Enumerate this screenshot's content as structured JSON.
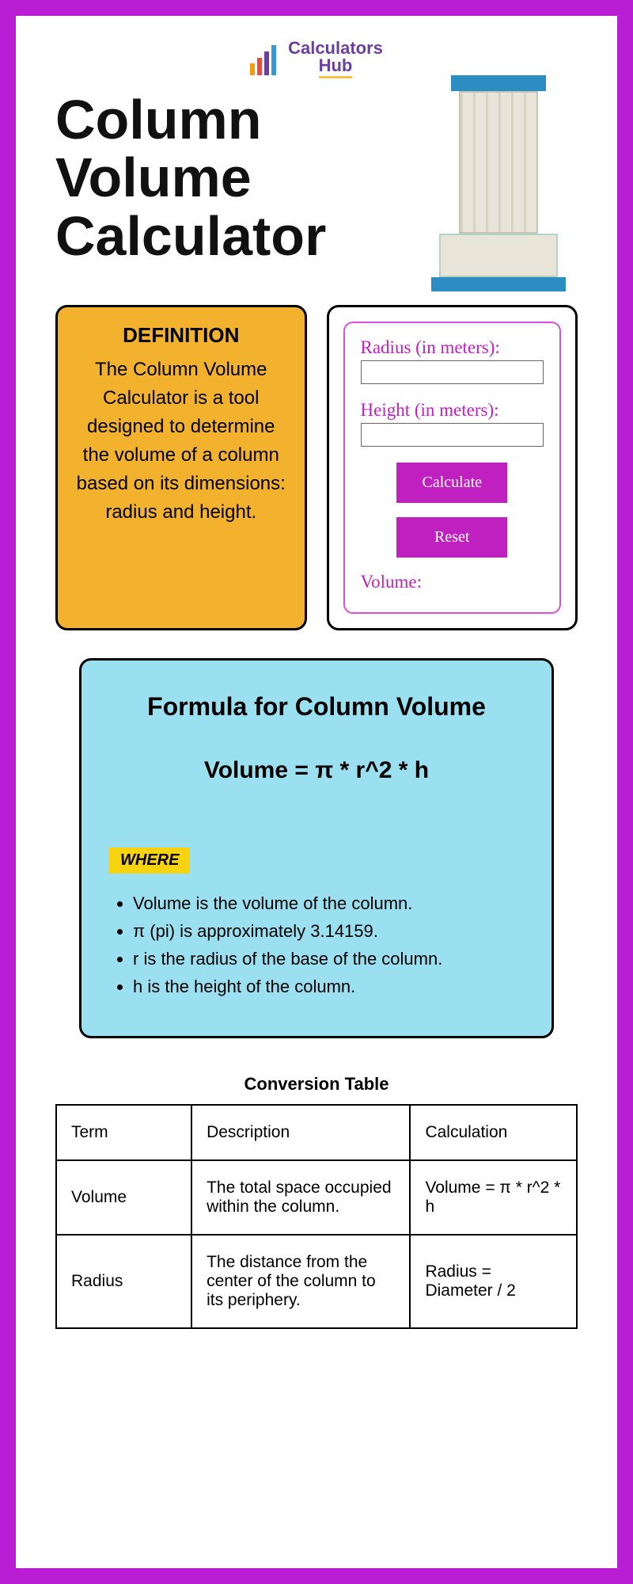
{
  "logo": {
    "name1": "Calculators",
    "name2": "Hub"
  },
  "title": "Column Volume Calculator",
  "definition": {
    "heading": "DEFINITION",
    "text": "The Column Volume Calculator is a tool designed to determine the volume of a column based on its dimensions: radius and height."
  },
  "calc": {
    "radius_label": "Radius (in meters):",
    "height_label": "Height (in meters):",
    "calculate": "Calculate",
    "reset": "Reset",
    "volume_label": "Volume:"
  },
  "formula": {
    "heading": "Formula for Column Volume",
    "equation": "Volume = π * r^2 * h",
    "where": "WHERE",
    "items": [
      "Volume is the volume of the column.",
      "π (pi) is approximately 3.14159.",
      "r is the radius of the base of the column.",
      "h is the height of the column."
    ]
  },
  "table": {
    "title": "Conversion Table",
    "header": {
      "c1": "Term",
      "c2": "Description",
      "c3": "Calculation"
    },
    "rows": [
      {
        "c1": "Volume",
        "c2": "The total space occupied within the column.",
        "c3": "Volume = π * r^2 * h"
      },
      {
        "c1": "Radius",
        "c2": "The distance from the center of the column to its periphery.",
        "c3": "Radius = Diameter / 2"
      }
    ]
  }
}
